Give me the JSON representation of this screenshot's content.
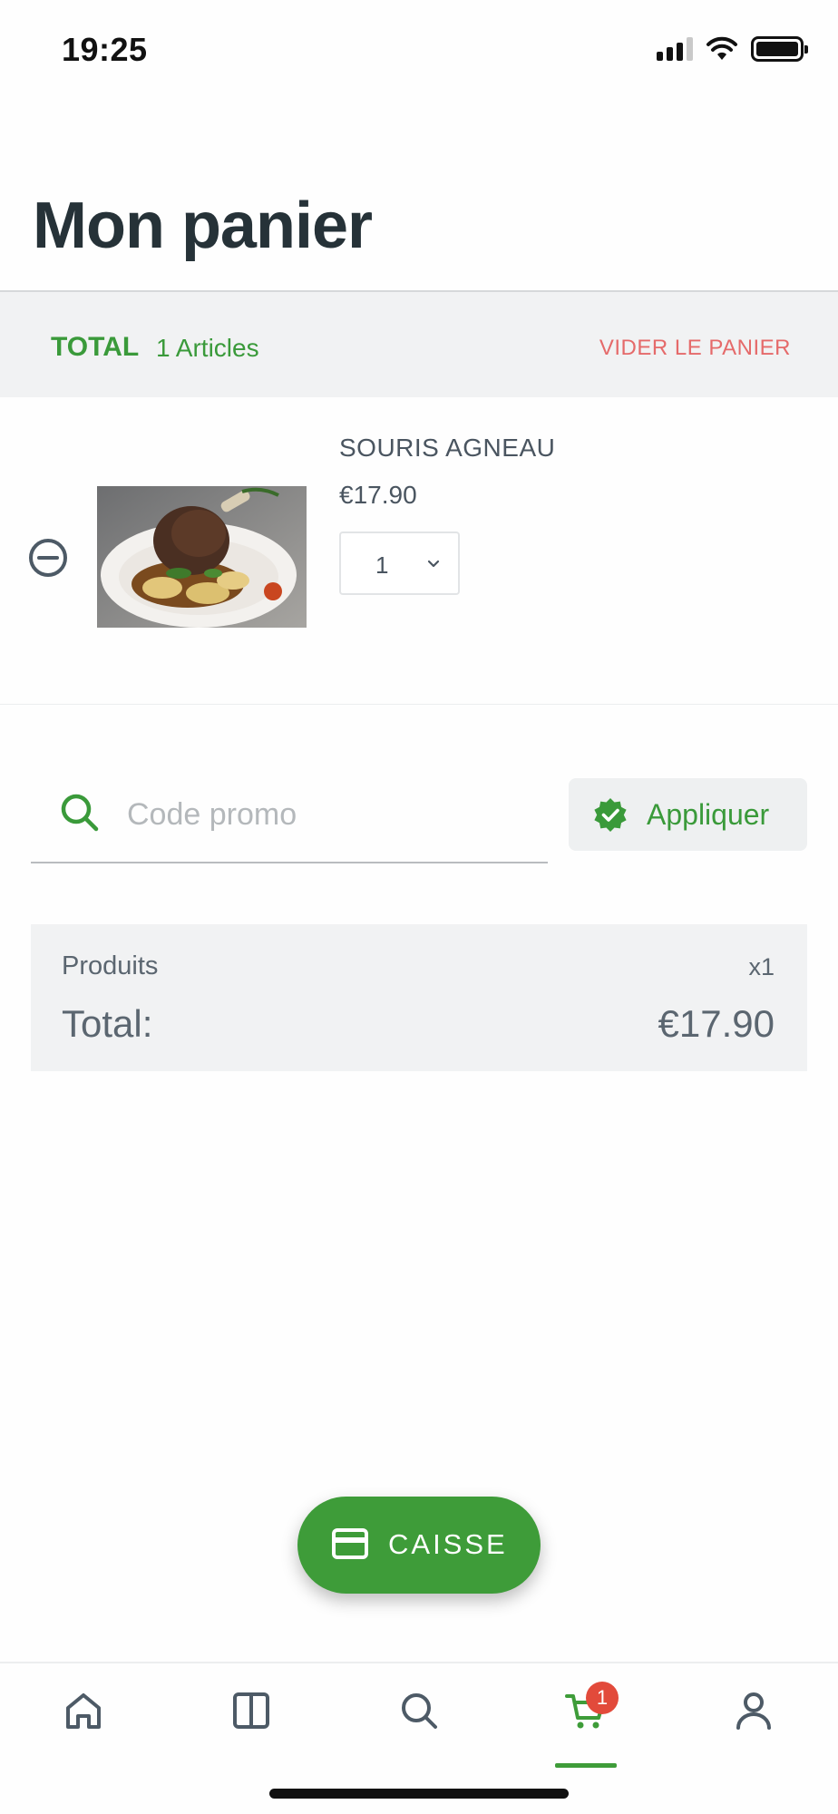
{
  "status_bar": {
    "time": "19:25"
  },
  "page": {
    "title": "Mon panier"
  },
  "cart_header": {
    "total_label": "TOTAL",
    "count_text": "1 Articles",
    "clear_label": "VIDER LE PANIER"
  },
  "items": [
    {
      "name": "SOURIS AGNEAU",
      "price": "€17.90",
      "quantity": "1"
    }
  ],
  "promo": {
    "placeholder": "Code promo",
    "apply_label": "Appliquer"
  },
  "summary": {
    "products_label": "Produits",
    "products_qty": "x1",
    "total_label": "Total:",
    "total_value": "€17.90"
  },
  "checkout": {
    "label": "CAISSE"
  },
  "nav": {
    "cart_badge": "1",
    "active_tab": "cart"
  },
  "colors": {
    "accent_green": "#3e9c39",
    "danger_red": "#e56a6a",
    "badge_red": "#e24a3b",
    "panel_gray": "#f1f2f3"
  }
}
